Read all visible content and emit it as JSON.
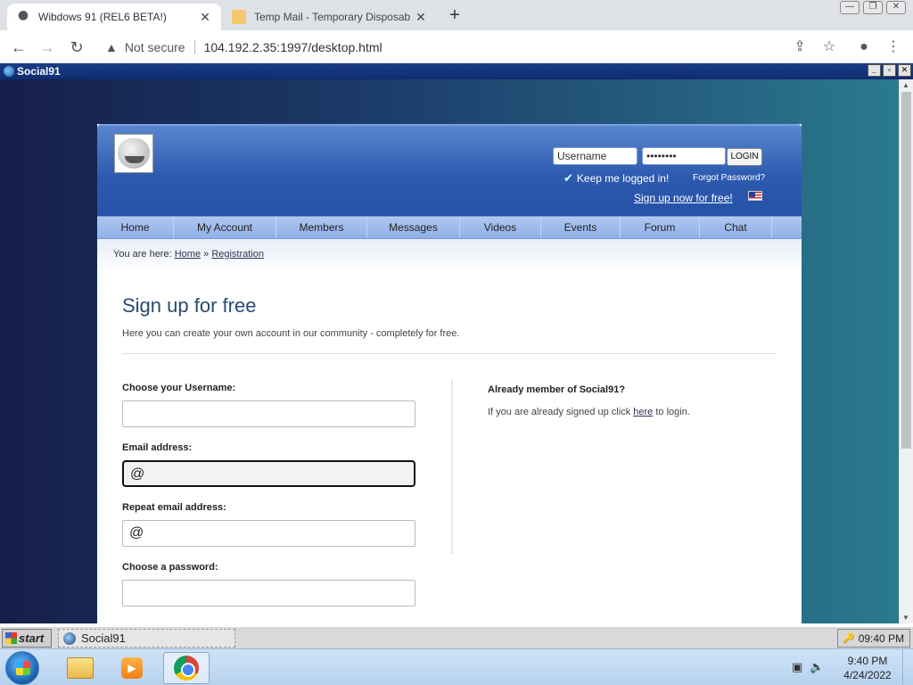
{
  "browser": {
    "tabs": [
      {
        "title": "Wibdows 91 (REL6 BETA!)",
        "active": true
      },
      {
        "title": "Temp Mail - Temporary Disposab",
        "active": false
      }
    ],
    "security_label": "Not secure",
    "url": "104.192.2.35:1997/desktop.html"
  },
  "window": {
    "title": "Social91"
  },
  "site": {
    "login": {
      "username_placeholder": "Username",
      "password_value": "••••••••",
      "login_label": "LOGIN",
      "keep_logged_in": "Keep me logged in!",
      "forgot": "Forgot Password?",
      "signup_link": "Sign up now for free!"
    },
    "menu": [
      "Home",
      "My Account",
      "Members",
      "Messages",
      "Videos",
      "Events",
      "Forum",
      "Chat"
    ],
    "breadcrumb": {
      "prefix": "You are here:",
      "home": "Home",
      "sep": "»",
      "current": "Registration"
    },
    "heading": "Sign up for free",
    "intro": "Here you can create your own account in our community - completely for free.",
    "form": {
      "username_label": "Choose your Username:",
      "username_value": "",
      "email_label": "Email address:",
      "email_value": "@",
      "repeat_email_label": "Repeat email address:",
      "repeat_email_value": "@",
      "password_label": "Choose a password:",
      "password_value": ""
    },
    "sidebar": {
      "title": "Already member of Social91?",
      "text_before": "If you are already signed up click",
      "link": "here",
      "text_after": "to login."
    }
  },
  "taskbar91": {
    "start_label": "start",
    "task_label": "Social91",
    "clock": "09:40 PM"
  },
  "windows_taskbar": {
    "time": "9:40 PM",
    "date": "4/24/2022"
  }
}
